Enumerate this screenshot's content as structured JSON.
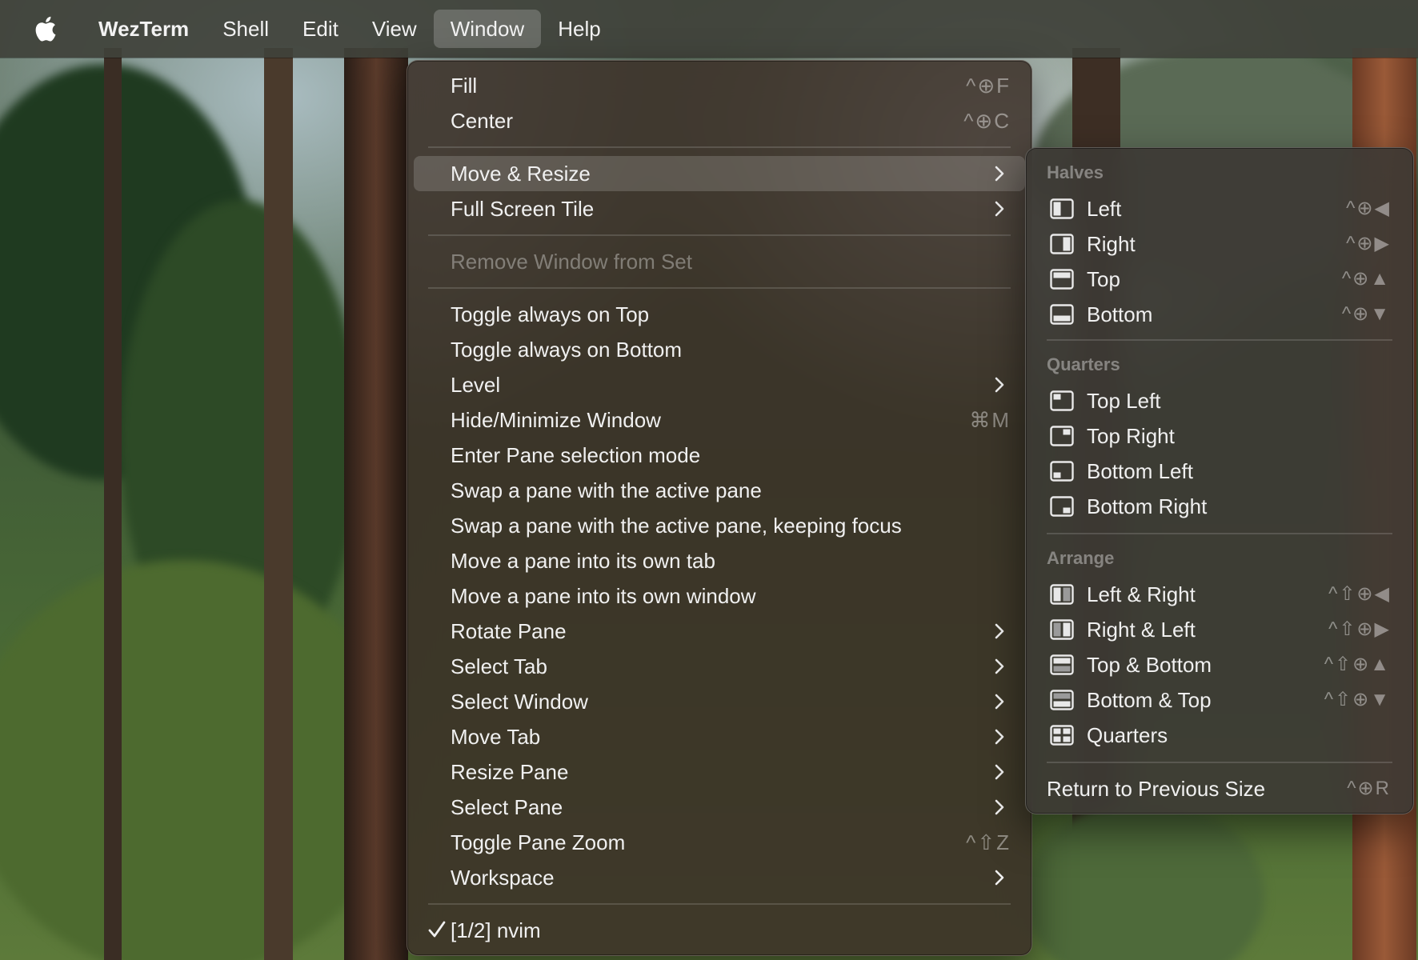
{
  "menubar": {
    "app_name": "WezTerm",
    "items": [
      "Shell",
      "Edit",
      "View",
      "Window",
      "Help"
    ]
  },
  "window_menu": {
    "fill": {
      "label": "Fill",
      "shortcut": "^⊕F"
    },
    "center": {
      "label": "Center",
      "shortcut": "^⊕C"
    },
    "move_resize": {
      "label": "Move & Resize"
    },
    "full_screen_tile": {
      "label": "Full Screen Tile"
    },
    "remove_window": {
      "label": "Remove Window from Set"
    },
    "items": [
      {
        "label": "Toggle always on Top"
      },
      {
        "label": "Toggle always on Bottom"
      },
      {
        "label": "Level"
      },
      {
        "label": "Hide/Minimize Window",
        "shortcut": "⌘M"
      },
      {
        "label": "Enter Pane selection mode"
      },
      {
        "label": "Swap a pane with the active pane"
      },
      {
        "label": "Swap a pane with the active pane, keeping focus"
      },
      {
        "label": "Move a pane into its own tab"
      },
      {
        "label": "Move a pane into its own window"
      },
      {
        "label": "Rotate Pane"
      },
      {
        "label": "Select Tab"
      },
      {
        "label": "Select Window"
      },
      {
        "label": "Move Tab"
      },
      {
        "label": "Resize Pane"
      },
      {
        "label": "Select Pane"
      },
      {
        "label": "Toggle Pane Zoom",
        "shortcut": "^⇧Z"
      },
      {
        "label": "Workspace"
      }
    ],
    "window_entry": {
      "label": "[1/2] nvim"
    }
  },
  "move_resize_submenu": {
    "halves_title": "Halves",
    "halves": [
      {
        "label": "Left",
        "shortcut": "^⊕◀",
        "icon": "half-left-icon"
      },
      {
        "label": "Right",
        "shortcut": "^⊕▶",
        "icon": "half-right-icon"
      },
      {
        "label": "Top",
        "shortcut": "^⊕▲",
        "icon": "half-top-icon"
      },
      {
        "label": "Bottom",
        "shortcut": "^⊕▼",
        "icon": "half-bottom-icon"
      }
    ],
    "quarters_title": "Quarters",
    "quarters": [
      {
        "label": "Top Left",
        "icon": "quarter-top-left-icon"
      },
      {
        "label": "Top Right",
        "icon": "quarter-top-right-icon"
      },
      {
        "label": "Bottom Left",
        "icon": "quarter-bottom-left-icon"
      },
      {
        "label": "Bottom Right",
        "icon": "quarter-bottom-right-icon"
      }
    ],
    "arrange_title": "Arrange",
    "arrange": [
      {
        "label": "Left & Right",
        "shortcut": "^⇧⊕◀",
        "icon": "arrange-left-right-icon"
      },
      {
        "label": "Right & Left",
        "shortcut": "^⇧⊕▶",
        "icon": "arrange-right-left-icon"
      },
      {
        "label": "Top & Bottom",
        "shortcut": "^⇧⊕▲",
        "icon": "arrange-top-bottom-icon"
      },
      {
        "label": "Bottom & Top",
        "shortcut": "^⇧⊕▼",
        "icon": "arrange-bottom-top-icon"
      },
      {
        "label": "Quarters",
        "icon": "arrange-quarters-icon"
      }
    ],
    "return": {
      "label": "Return to Previous Size",
      "shortcut": "^⊕R"
    }
  }
}
